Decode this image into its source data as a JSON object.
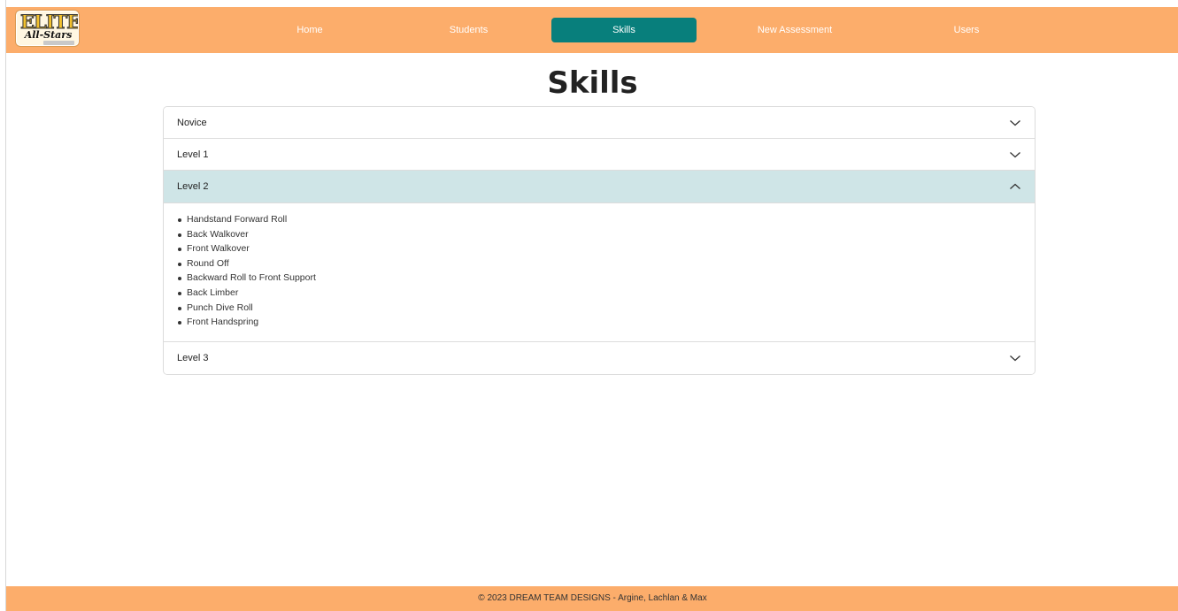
{
  "logo": {
    "line1": "ELITE",
    "line2": "All-Stars"
  },
  "nav": {
    "items": [
      {
        "label": "Home"
      },
      {
        "label": "Students"
      },
      {
        "label": "Skills"
      },
      {
        "label": "New Assessment"
      },
      {
        "label": "Users"
      }
    ],
    "active": "Skills",
    "color_bar": "#fcad6b",
    "color_active": "#087f7c"
  },
  "page": {
    "title": "Skills"
  },
  "accordion": {
    "sections": [
      {
        "title": "Novice",
        "expanded": false,
        "icon": "chevron-down-icon"
      },
      {
        "title": "Level 1",
        "expanded": false,
        "icon": "chevron-down-icon"
      },
      {
        "title": "Level 2",
        "expanded": true,
        "icon": "chevron-up-icon",
        "skills": [
          "Handstand Forward Roll",
          "Back Walkover",
          "Front Walkover",
          "Round Off",
          "Backward Roll to Front Support",
          "Back Limber",
          "Punch Dive Roll",
          "Front Handspring"
        ]
      },
      {
        "title": "Level 3",
        "expanded": false,
        "icon": "chevron-down-icon"
      }
    ],
    "color_open": "#cfe5e7"
  },
  "footer": {
    "text": "© 2023 DREAM TEAM DESIGNS - Argine, Lachlan & Max"
  }
}
